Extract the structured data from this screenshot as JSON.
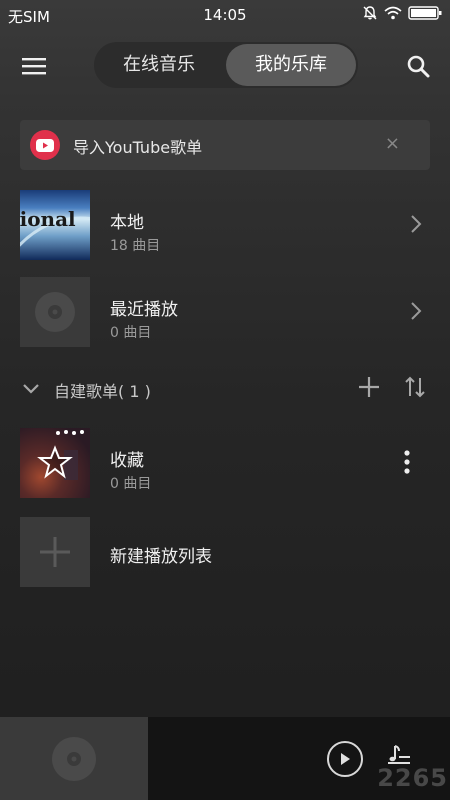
{
  "status_bar": {
    "carrier": "无SIM",
    "time": "14:05"
  },
  "header": {
    "tabs": [
      {
        "label": "在线音乐",
        "active": false
      },
      {
        "label": "我的乐库",
        "active": true
      }
    ]
  },
  "import_banner": {
    "label": "导入YouTube歌单",
    "close": "×",
    "accent_color": "#e0304b"
  },
  "library": {
    "local": {
      "title": "本地",
      "count": "18 曲目"
    },
    "recent": {
      "title": "最近播放",
      "count": "0 曲目"
    }
  },
  "playlists_section": {
    "label": "自建歌单",
    "count": "( 1 )",
    "playlists": [
      {
        "title": "收藏",
        "count": "0 曲目"
      }
    ],
    "new_playlist_label": "新建播放列表"
  },
  "watermark": "2265"
}
